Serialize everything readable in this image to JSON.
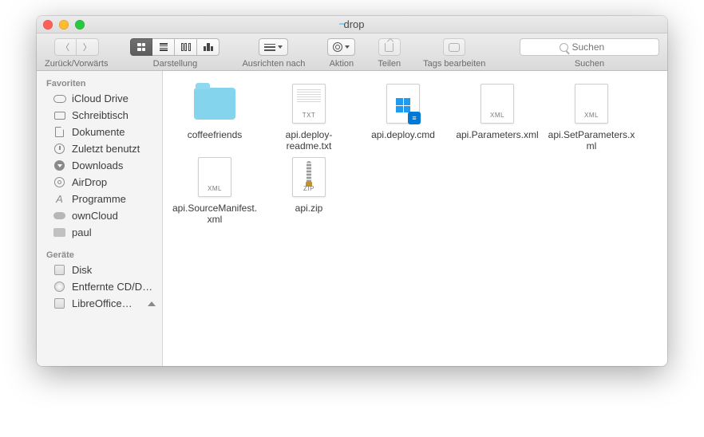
{
  "window": {
    "title": "drop"
  },
  "toolbar": {
    "nav_label": "Zurück/Vorwärts",
    "view_label": "Darstellung",
    "arrange_label": "Ausrichten nach",
    "action_label": "Aktion",
    "share_label": "Teilen",
    "tags_label": "Tags bearbeiten",
    "search_label": "Suchen",
    "search_placeholder": "Suchen"
  },
  "sidebar": {
    "sections": [
      {
        "title": "Favoriten",
        "items": [
          {
            "label": "iCloud Drive",
            "icon": "cloud"
          },
          {
            "label": "Schreibtisch",
            "icon": "desk"
          },
          {
            "label": "Dokumente",
            "icon": "doc"
          },
          {
            "label": "Zuletzt benutzt",
            "icon": "clock"
          },
          {
            "label": "Downloads",
            "icon": "down"
          },
          {
            "label": "AirDrop",
            "icon": "air"
          },
          {
            "label": "Programme",
            "icon": "app"
          },
          {
            "label": "ownCloud",
            "icon": "own"
          },
          {
            "label": "paul",
            "icon": "fold"
          }
        ]
      },
      {
        "title": "Geräte",
        "items": [
          {
            "label": "Disk",
            "icon": "disk"
          },
          {
            "label": "Entfernte CD/D…",
            "icon": "cd"
          },
          {
            "label": "LibreOffice…",
            "icon": "disk",
            "eject": true
          }
        ]
      }
    ]
  },
  "files": [
    {
      "name": "coffeefriends",
      "type": "folder"
    },
    {
      "name": "api.deploy-readme.txt",
      "type": "txt",
      "tag": "TXT"
    },
    {
      "name": "api.deploy.cmd",
      "type": "cmd"
    },
    {
      "name": "api.Parameters.xml",
      "type": "xml",
      "tag": "XML"
    },
    {
      "name": "api.SetParameters.xml",
      "type": "xml",
      "tag": "XML"
    },
    {
      "name": "api.SourceManifest.xml",
      "type": "xml",
      "tag": "XML"
    },
    {
      "name": "api.zip",
      "type": "zip",
      "tag": "ZIP"
    }
  ]
}
